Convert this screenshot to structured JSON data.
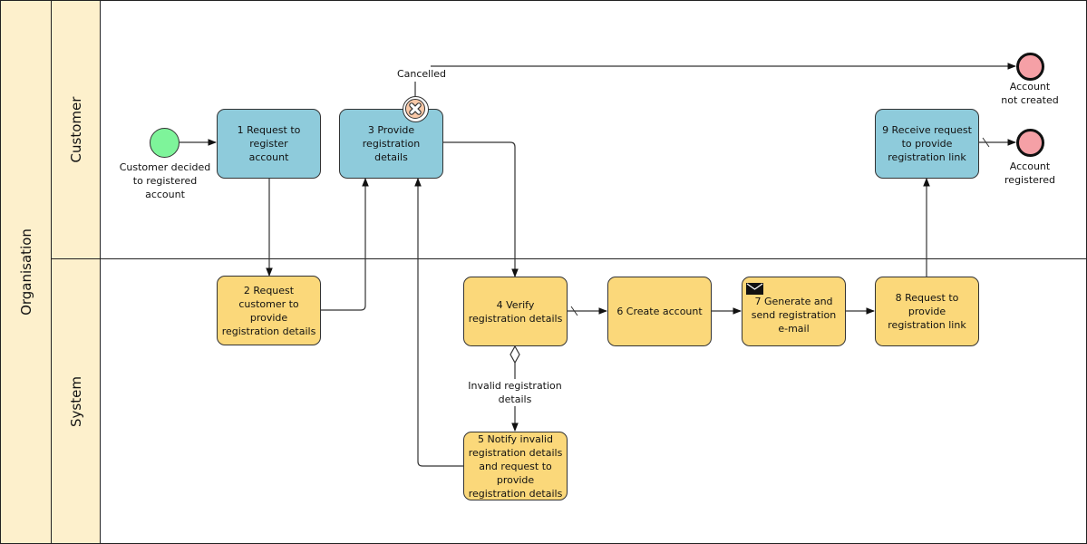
{
  "pool": {
    "label": "Organisation"
  },
  "lanes": [
    {
      "label": "Customer"
    },
    {
      "label": "System"
    }
  ],
  "events": {
    "start": {
      "label": "Customer decided to registered account",
      "lines": [
        "Customer decided",
        "to registered",
        "account"
      ],
      "color": "#7ef49a"
    },
    "cancelled": {
      "label": "Cancelled",
      "icon": "cancel-x-icon",
      "color": "#f9c9a8"
    },
    "end_not_created": {
      "label": "Account not created",
      "lines": [
        "Account",
        "not created"
      ],
      "color": "#f5a0a6"
    },
    "end_registered": {
      "label": "Account registered",
      "lines": [
        "Account",
        "registered"
      ],
      "color": "#f5a0a6"
    }
  },
  "tasks": [
    {
      "id": "t1",
      "label": "1 Request to register account",
      "lane": "Customer",
      "color": "#8ecbdb"
    },
    {
      "id": "t2",
      "label": "2 Request customer to provide registration details",
      "lane": "System",
      "color": "#fbd87a"
    },
    {
      "id": "t3",
      "label": "3 Provide registration details",
      "lane": "Customer",
      "color": "#8ecbdb"
    },
    {
      "id": "t4",
      "label": "4 Verify registration details",
      "lane": "System",
      "color": "#fbd87a"
    },
    {
      "id": "t5",
      "label": "5 Notify invalid registration details and request to provide registration details",
      "lane": "System",
      "color": "#fbd87a"
    },
    {
      "id": "t6",
      "label": "6 Create account",
      "lane": "System",
      "color": "#fbd87a"
    },
    {
      "id": "t7",
      "label": "7 Generate and send registration e-mail",
      "lane": "System",
      "color": "#fbd87a",
      "icon": "envelope-icon"
    },
    {
      "id": "t8",
      "label": "8 Request to provide registration link",
      "lane": "System",
      "color": "#fbd87a"
    },
    {
      "id": "t9",
      "label": "9 Receive request to provide registration link",
      "lane": "Customer",
      "color": "#8ecbdb"
    }
  ],
  "flows": {
    "invalid_label": {
      "lines": [
        "Invalid registration",
        "details"
      ]
    }
  }
}
